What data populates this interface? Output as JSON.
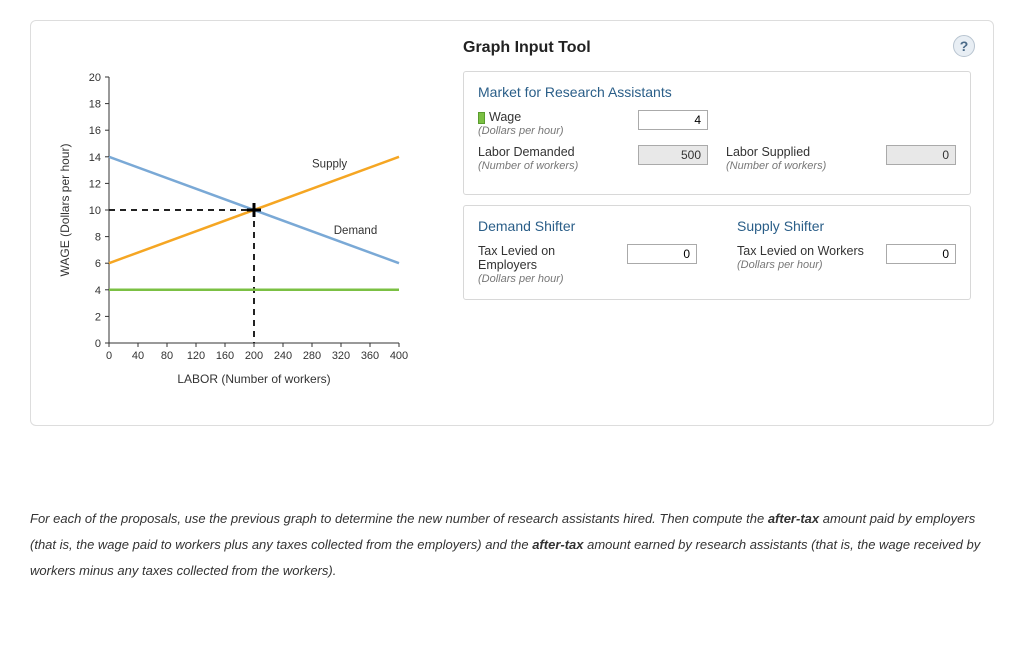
{
  "tool_title": "Graph Input Tool",
  "help_glyph": "?",
  "market": {
    "title": "Market for Research Assistants",
    "wage": {
      "label": "Wage",
      "sub": "(Dollars per hour)",
      "value": "4"
    },
    "labor_demanded": {
      "label": "Labor Demanded",
      "sub": "(Number of workers)",
      "value": "500"
    },
    "labor_supplied": {
      "label": "Labor Supplied",
      "sub": "(Number of workers)",
      "value": "0"
    }
  },
  "shifters": {
    "demand_title": "Demand Shifter",
    "supply_title": "Supply Shifter",
    "tax_employers": {
      "label": "Tax Levied on Employers",
      "sub": "(Dollars per hour)",
      "value": "0"
    },
    "tax_workers": {
      "label": "Tax Levied on Workers",
      "sub": "(Dollars per hour)",
      "value": "0"
    }
  },
  "instructions": {
    "p1a": "For each of the proposals, use the previous graph to determine the new number of research assistants hired. Then compute the ",
    "p1b": "after-tax",
    "p1c": " amount paid by employers (that is, the wage paid to workers plus any taxes collected from the employers) and the ",
    "p1d": "after-tax",
    "p1e": " amount earned by research assistants (that is, the wage received by workers minus any taxes collected from the workers)."
  },
  "chart_data": {
    "type": "line",
    "xlabel": "LABOR (Number of workers)",
    "ylabel": "WAGE (Dollars per hour)",
    "xlim": [
      0,
      400
    ],
    "ylim": [
      0,
      20
    ],
    "xticks": [
      0,
      40,
      80,
      120,
      160,
      200,
      240,
      280,
      320,
      360,
      400
    ],
    "yticks": [
      0,
      2,
      4,
      6,
      8,
      10,
      12,
      14,
      16,
      18,
      20
    ],
    "series": [
      {
        "name": "Supply",
        "color": "#f5a623",
        "points": [
          [
            0,
            6
          ],
          [
            400,
            14
          ]
        ]
      },
      {
        "name": "Demand",
        "color": "#7aa9d6",
        "points": [
          [
            0,
            14
          ],
          [
            400,
            6
          ]
        ]
      },
      {
        "name": "Wage",
        "color": "#7bc043",
        "points": [
          [
            0,
            4
          ],
          [
            400,
            4
          ]
        ]
      }
    ],
    "equilibrium": {
      "x": 200,
      "y": 10
    },
    "dashed_guides": [
      {
        "from": [
          0,
          10
        ],
        "to": [
          200,
          10
        ]
      },
      {
        "from": [
          200,
          10
        ],
        "to": [
          200,
          0
        ]
      }
    ]
  }
}
